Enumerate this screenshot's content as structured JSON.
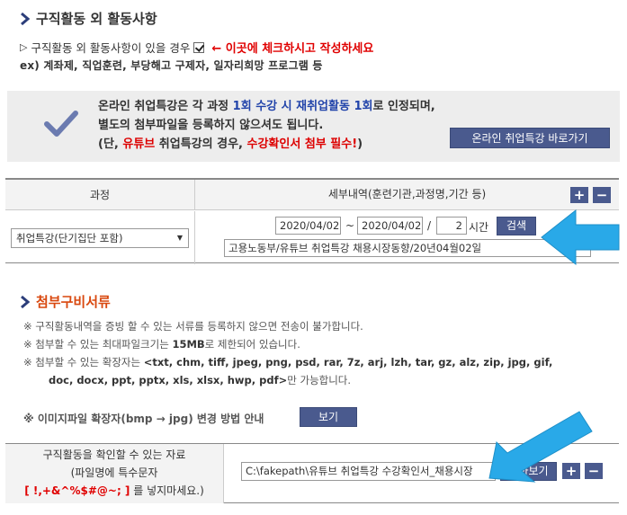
{
  "section1": {
    "title": "구직활동 외 활동사항",
    "check_line_prefix": "구직활동 외 활동사항이 있을 경우",
    "check_instruction": "← 이곳에 체크하시고 작성하세요",
    "example_line": "ex) 계좌제, 직업훈련, 부당해고 구제자, 일자리희망 프로그램 등"
  },
  "notice": {
    "l1_a": "온라인 취업특강은 각 과정 ",
    "l1_blue": "1회 수강 시 재취업활동 1회",
    "l1_b": "로 인정되며,",
    "l2": "별도의 첨부파일을 등록하지 않으셔도 됩니다.",
    "l3_a": "(단, ",
    "l3_red1": "유튜브",
    "l3_b": " 취업특강의 경우, ",
    "l3_red2": "수강확인서 첨부 필수!",
    "l3_c": ")",
    "button": "온라인 취업특강 바로가기"
  },
  "course_table": {
    "col_course": "과정",
    "col_detail": "세부내역(훈련기관,과정명,기간 등)",
    "plus": "+",
    "minus": "−",
    "course_select": "취업특강(단기집단 포함)",
    "date_from": "2020/04/02",
    "tilde": "~",
    "date_to": "2020/04/02",
    "slash": "/",
    "hours": "2",
    "hours_unit": "시간",
    "search_button": "검색",
    "detail_value": "고용노동부/유튜브 취업특강 채용시장동향/20년04월02일"
  },
  "section2": {
    "title": "첨부구비서류",
    "note1": "※ 구직활동내역을 증빙 할 수 있는 서류를 등록하지 않으면 전송이 불가합니다.",
    "note2_a": "※ 첨부할 수 있는 최대파일크기는 ",
    "note2_b": "15MB",
    "note2_c": "로 제한되어 있습니다.",
    "note3_a": "※ 첨부할 수 있는 확장자는 ",
    "note3_b": "<txt, chm, tiff, jpeg, png, psd, rar, 7z, arj, lzh, tar, gz, alz, zip, jpg, gif,",
    "note3_c": "doc, docx, ppt, pptx, xls, xlsx, hwp, pdf>",
    "note3_d": "만 가능합니다.",
    "image_note": "※ 이미지파일 확장자(bmp → jpg) 변경 방법 안내",
    "view_button": "보기"
  },
  "attach_table": {
    "label_line1": "구직활동을 확인할 수 있는 자료",
    "label_line2": "(파일명에 특수문자",
    "label_special": "[ !,+&^%$#@~; ]",
    "label_line3": "를 넣지마세요.)",
    "file_path": "C:\\fakepath\\유튜브 취업특강 수강확인서_채용시장",
    "browse_button": "찾아보기",
    "plus": "+",
    "minus": "−"
  },
  "colors": {
    "accent": "#4a5a8e",
    "arrow": "#29a9e8",
    "red": "#e00000",
    "orange": "#d9480f"
  }
}
